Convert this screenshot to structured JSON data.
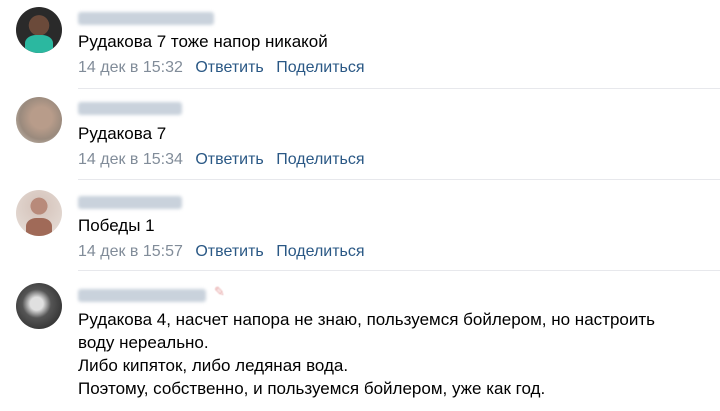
{
  "comments": [
    {
      "text_lines": [
        "Рудакова 7 тоже напор никакой"
      ],
      "date": "14 дек в 15:32",
      "reply_label": "Ответить",
      "share_label": "Поделиться"
    },
    {
      "text_lines": [
        "Рудакова 7"
      ],
      "date": "14 дек в 15:34",
      "reply_label": "Ответить",
      "share_label": "Поделиться"
    },
    {
      "text_lines": [
        "Победы 1"
      ],
      "date": "14 дек в 15:57",
      "reply_label": "Ответить",
      "share_label": "Поделиться"
    },
    {
      "text_lines": [
        "Рудакова 4, насчет напора не знаю, пользуемся бойлером, но настроить",
        "воду нереально.",
        "Либо кипяток, либо ледяная вода.",
        "Поэтому, собственно, и пользуемся бойлером, уже как год."
      ]
    }
  ],
  "colors": {
    "link": "#2a5885",
    "meta": "#818c99",
    "divider": "#e7e8ec"
  }
}
